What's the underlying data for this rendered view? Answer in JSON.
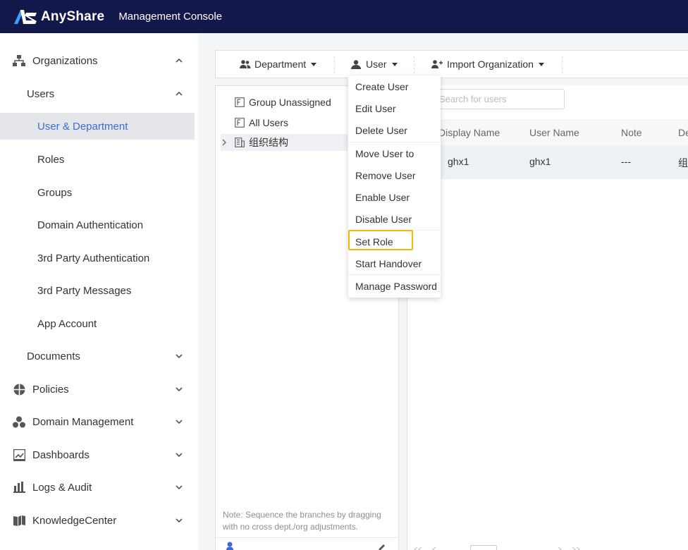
{
  "header": {
    "brand": "AnyShare",
    "console_title": "Management Console"
  },
  "sidebar": {
    "items": [
      {
        "label": "Organizations",
        "icon": "org-chart-icon",
        "chevron": "up"
      },
      {
        "label": "Users",
        "chevron": "up"
      },
      {
        "label": "User & Department",
        "active": true
      },
      {
        "label": "Roles"
      },
      {
        "label": "Groups"
      },
      {
        "label": "Domain Authentication"
      },
      {
        "label": "3rd Party Authentication"
      },
      {
        "label": "3rd Party Messages"
      },
      {
        "label": "App Account"
      },
      {
        "label": "Documents",
        "chevron": "down"
      },
      {
        "label": "Policies",
        "icon": "shield-icon",
        "chevron": "down"
      },
      {
        "label": "Domain Management",
        "icon": "domain-icon",
        "chevron": "down"
      },
      {
        "label": "Dashboards",
        "icon": "dashboard-icon",
        "chevron": "down"
      },
      {
        "label": "Logs & Audit",
        "icon": "bar-chart-icon",
        "chevron": "down"
      },
      {
        "label": "KnowledgeCenter",
        "icon": "book-icon",
        "chevron": "down"
      }
    ]
  },
  "toolbar": {
    "department_label": "Department",
    "user_label": "User",
    "import_label": "Import Organization"
  },
  "tree": {
    "items": [
      {
        "label": "Group Unassigned"
      },
      {
        "label": "All Users"
      },
      {
        "label": "组织结构"
      }
    ],
    "note": "Note: Sequence the branches by dragging with no cross dept./org adjustments."
  },
  "grid": {
    "search_placeholder": "Search for users",
    "columns": [
      "Display Name",
      "User Name",
      "Note",
      "De"
    ],
    "rows": [
      {
        "display_name": "ghx1",
        "user_name": "ghx1",
        "note": "---",
        "dept": "组"
      }
    ]
  },
  "user_menu": {
    "items": [
      "Create User",
      "Edit User",
      "Delete User",
      "Move User to",
      "Remove User",
      "Enable User",
      "Disable User",
      "Set Role",
      "Start Handover",
      "Manage Password"
    ],
    "highlighted": "Set Role"
  },
  "colors": {
    "header_bg": "#13174a",
    "accent": "#3c6bd6",
    "highlight": "#f5b700",
    "logo_blue": "#3aa0ff"
  }
}
